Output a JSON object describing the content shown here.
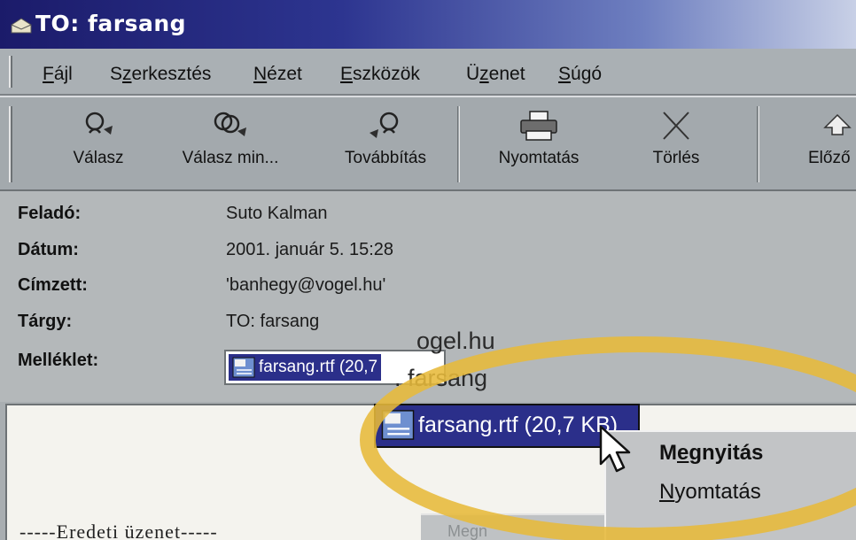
{
  "window": {
    "title": "TO: farsang",
    "title_icon": "envelope-icon"
  },
  "menu": {
    "file": {
      "pre": "",
      "key": "F",
      "post": "ájl"
    },
    "edit": {
      "pre": "S",
      "key": "z",
      "post": "erkesztés"
    },
    "view": {
      "pre": "",
      "key": "N",
      "post": "ézet"
    },
    "tools": {
      "pre": "",
      "key": "E",
      "post": "szközök"
    },
    "message": {
      "pre": "Ü",
      "key": "z",
      "post": "enet"
    },
    "help": {
      "pre": "",
      "key": "S",
      "post": "úgó"
    }
  },
  "toolbar": {
    "reply": "Válasz",
    "reply_all": "Válasz min...",
    "forward": "Továbbítás",
    "print": "Nyomtatás",
    "delete": "Törlés",
    "previous": "Előző"
  },
  "header": {
    "from_label": "Feladó:",
    "from_value": "Suto Kalman",
    "date_label": "Dátum:",
    "date_value": "2001. január 5. 15:28",
    "to_label": "Címzett:",
    "to_value": "'banhegy@vogel.hu'",
    "subject_label": "Tárgy:",
    "subject_value": "TO: farsang",
    "attachment_label": "Melléklet:",
    "attachment_value": "farsang.rtf (20,7"
  },
  "zoom": {
    "to_fragment": "ogel.hu",
    "subject_fragment": ". farsang",
    "attachment": "farsang.rtf (20,7 KB)"
  },
  "context_menu": {
    "open": {
      "pre": "M",
      "key": "e",
      "post": "gnyitás"
    },
    "print": {
      "pre": "",
      "key": "N",
      "post": "yomtatás"
    },
    "ghost": "Megn"
  },
  "body": {
    "original_message": "-----Eredeti üzenet-----"
  },
  "colors": {
    "title_start": "#1b1b6a",
    "selection": "#2b2f8a",
    "highlight_ring": "#e7b93a"
  }
}
